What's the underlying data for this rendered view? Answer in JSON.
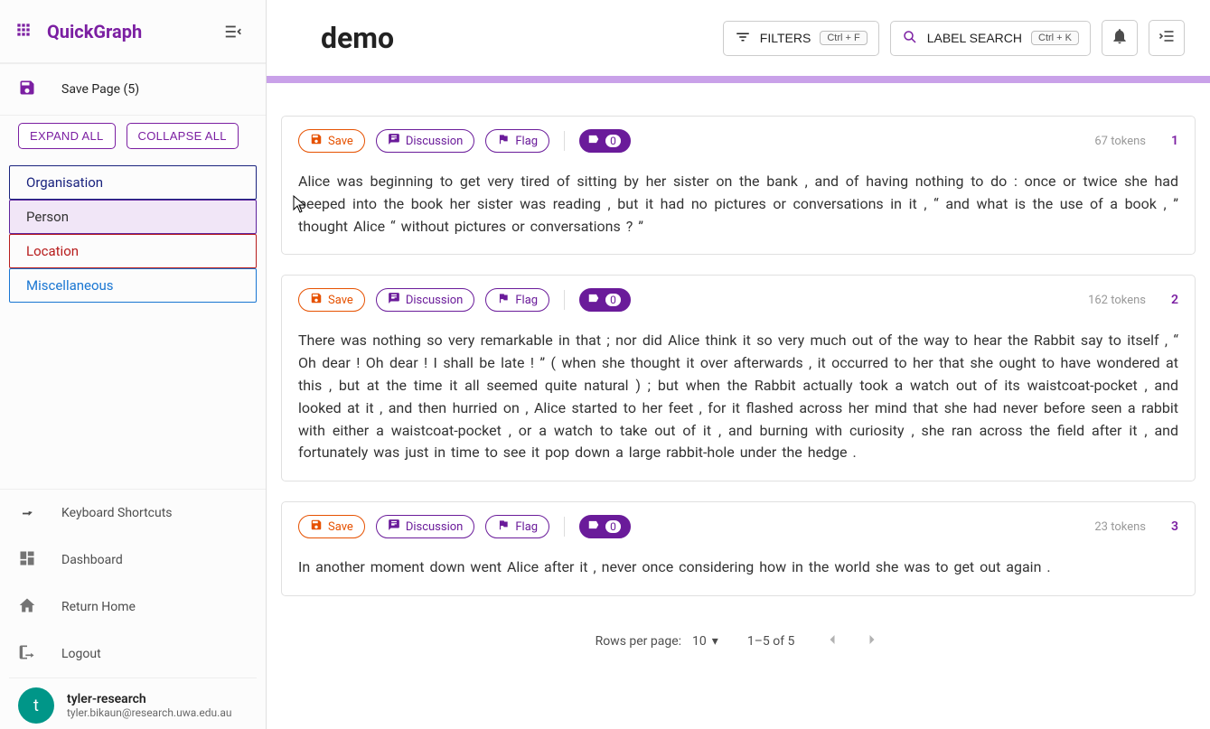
{
  "brand": "QuickGraph",
  "title": "demo",
  "topbar": {
    "filters_label": "FILTERS",
    "filters_kbd": "Ctrl + F",
    "search_label": "LABEL SEARCH",
    "search_kbd": "Ctrl + K"
  },
  "sidebar": {
    "save_page_label": "Save Page (5)",
    "expand_label": "EXPAND ALL",
    "collapse_label": "COLLAPSE ALL",
    "labels": {
      "organisation": "Organisation",
      "person": "Person",
      "location": "Location",
      "misc": "Miscellaneous"
    },
    "links": {
      "shortcuts": "Keyboard Shortcuts",
      "dashboard": "Dashboard",
      "home": "Return Home",
      "logout": "Logout"
    },
    "user": {
      "initial": "t",
      "name": "tyler-research",
      "email": "tyler.bikaun@research.uwa.edu.au"
    }
  },
  "cards": [
    {
      "save": "Save",
      "discussion": "Discussion",
      "flag": "Flag",
      "count": "0",
      "tokens": "67 tokens",
      "index": "1",
      "text": "Alice was beginning to get very tired of sitting by her sister on the bank , and of having nothing to do : once or twice she had peeped into the book her sister was reading , but it had no pictures or conversations in it , “ and what is the use of a book , ” thought Alice “ without pictures or conversations ? ”"
    },
    {
      "save": "Save",
      "discussion": "Discussion",
      "flag": "Flag",
      "count": "0",
      "tokens": "162 tokens",
      "index": "2",
      "text": "There was nothing so very remarkable in that ; nor did Alice think it so very much out of the way to hear the Rabbit say to itself , “ Oh dear ! Oh dear ! I shall be late ! ” ( when she thought it over afterwards , it occurred to her that she ought to have wondered at this , but at the time it all seemed quite natural ) ; but when the Rabbit actually took a watch out of its waistcoat-pocket , and looked at it , and then hurried on , Alice started to her feet , for it flashed across her mind that she had never before seen a rabbit with either a waistcoat-pocket , or a watch to take out of it , and burning with curiosity , she ran across the field after it , and fortunately was just in time to see it pop down a large rabbit-hole under the hedge ."
    },
    {
      "save": "Save",
      "discussion": "Discussion",
      "flag": "Flag",
      "count": "0",
      "tokens": "23 tokens",
      "index": "3",
      "text": "In another moment down went Alice after it , never once considering how in the world she was to get out again ."
    }
  ],
  "pager": {
    "rpp_label": "Rows per page:",
    "rpp_value": "10",
    "range": "1–5 of 5"
  }
}
